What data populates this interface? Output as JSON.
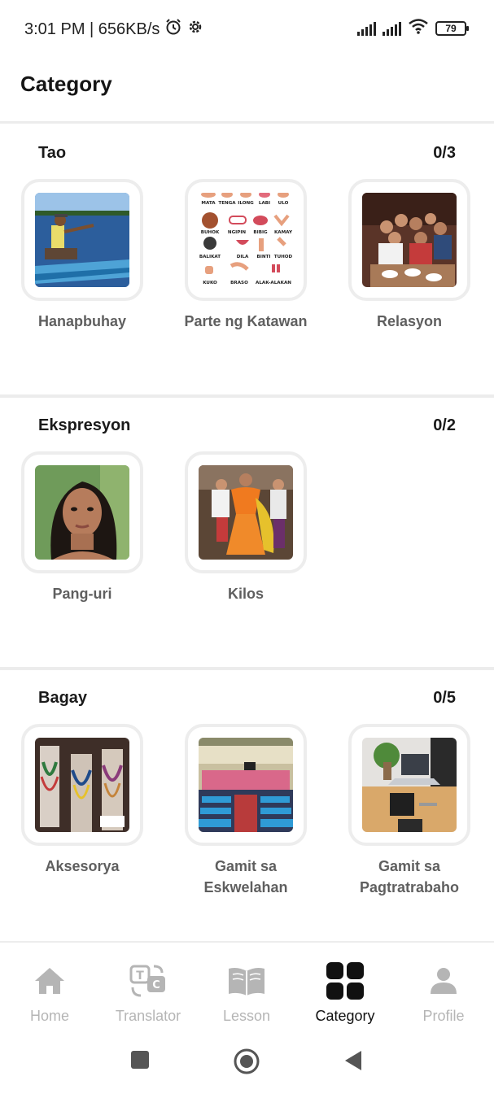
{
  "status_bar": {
    "time_speed": "3:01 PM | 656KB/s",
    "battery": "79",
    "icons": [
      "alarm-icon",
      "gear-icon",
      "signal-icon",
      "signal-icon",
      "wifi-icon",
      "battery-icon"
    ]
  },
  "header": {
    "title": "Category"
  },
  "sections": [
    {
      "title": "Tao",
      "count": "0/3",
      "items": [
        {
          "label": "Hanapbuhay"
        },
        {
          "label": "Parte ng Katawan"
        },
        {
          "label": "Relasyon"
        }
      ]
    },
    {
      "title": "Ekspresyon",
      "count": "0/2",
      "items": [
        {
          "label": "Pang-uri"
        },
        {
          "label": "Kilos"
        }
      ]
    },
    {
      "title": "Bagay",
      "count": "0/5",
      "items": [
        {
          "label": "Aksesorya"
        },
        {
          "label": "Gamit sa\nEskwelahan"
        },
        {
          "label": "Gamit sa\nPagtratrabaho"
        }
      ]
    }
  ],
  "body_parts_chart": {
    "row1": [
      "MATA",
      "TENGA",
      "ILONG",
      "LABI",
      "ULO"
    ],
    "row2": [
      "BUHOK",
      "NGIPIN",
      "BIBIG",
      "KAMAY"
    ],
    "row3": [
      "BALIKAT",
      "DILA",
      "BINTI",
      "TUHOD"
    ],
    "row4": [
      "KUKO",
      "BRASO",
      "ALAK-ALAKAN"
    ]
  },
  "bottom_nav": {
    "items": [
      {
        "label": "Home",
        "icon": "home-icon",
        "active": false
      },
      {
        "label": "Translator",
        "icon": "translator-icon",
        "active": false
      },
      {
        "label": "Lesson",
        "icon": "book-icon",
        "active": false
      },
      {
        "label": "Category",
        "icon": "grid-icon",
        "active": true
      },
      {
        "label": "Profile",
        "icon": "profile-icon",
        "active": false
      }
    ]
  },
  "colors": {
    "accent": "#111111",
    "inactive": "#b5b5b5",
    "label": "#5f5f5f",
    "divider": "#ececec"
  }
}
